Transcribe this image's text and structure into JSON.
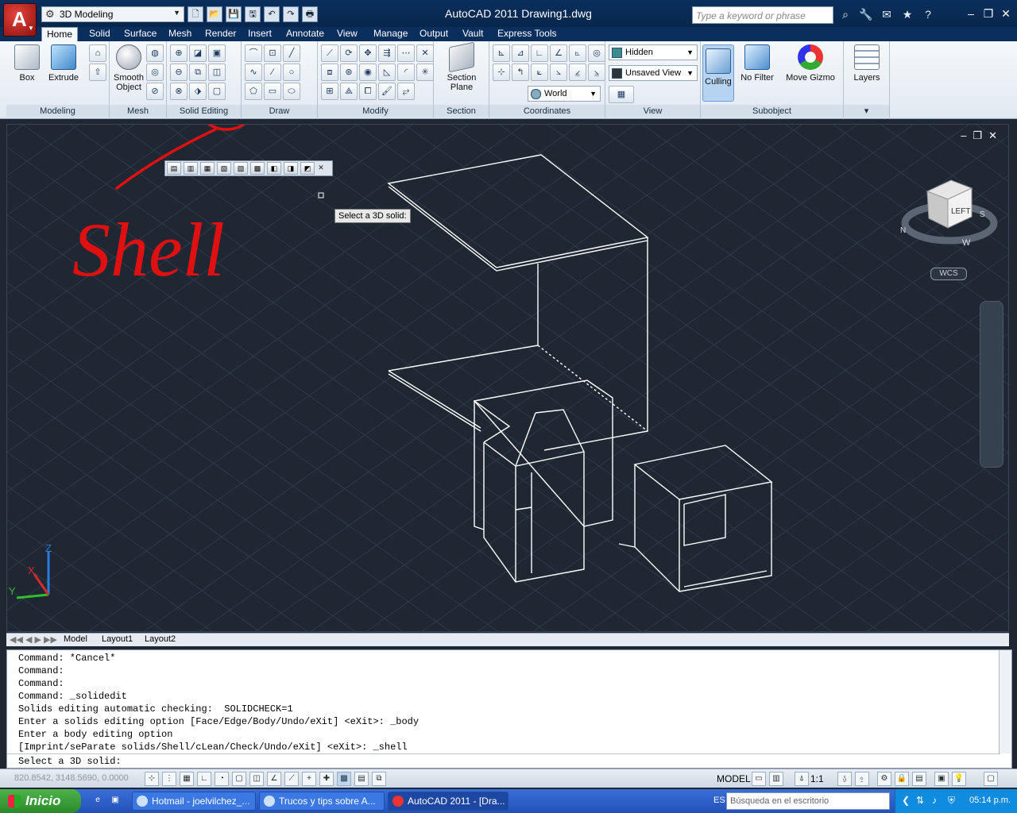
{
  "titlebar": {
    "workspace": "3D Modeling",
    "title": "AutoCAD 2011    Drawing1.dwg",
    "search_placeholder": "Type a keyword or phrase"
  },
  "tabs": [
    "Home",
    "Solid",
    "Surface",
    "Mesh",
    "Render",
    "Insert",
    "Annotate",
    "View",
    "Manage",
    "Output",
    "Vault",
    "Express Tools"
  ],
  "ribbon": {
    "modeling": {
      "title": "Modeling",
      "box": "Box",
      "extrude": "Extrude"
    },
    "mesh": {
      "title": "Mesh",
      "smooth": "Smooth Object"
    },
    "solid_editing": {
      "title": "Solid Editing"
    },
    "draw": {
      "title": "Draw"
    },
    "modify": {
      "title": "Modify"
    },
    "section": {
      "title": "Section",
      "plane": "Section Plane"
    },
    "coordinates": {
      "title": "Coordinates",
      "world": "World"
    },
    "view": {
      "title": "View",
      "visual_style": "Hidden",
      "saved_view": "Unsaved View"
    },
    "subobject": {
      "title": "Subobject",
      "culling": "Culling",
      "no_filter": "No Filter",
      "move_gizmo": "Move Gizmo"
    },
    "layers": {
      "label": "Layers"
    }
  },
  "viewport": {
    "tooltip": "Select a 3D solid:",
    "annotation": "Shell",
    "viewcube_face": "LEFT",
    "wcs": "WCS",
    "compass": {
      "n": "N",
      "s": "S",
      "w": "W"
    },
    "ucs": {
      "x": "X",
      "y": "Y",
      "z": "Z"
    }
  },
  "layout_tabs": [
    "Model",
    "Layout1",
    "Layout2"
  ],
  "command": {
    "history": [
      "Command: *Cancel*",
      "Command:",
      "Command:",
      "Command: _solidedit",
      "Solids editing automatic checking:  SOLIDCHECK=1",
      "Enter a solids editing option [Face/Edge/Body/Undo/eXit] <eXit>: _body",
      "Enter a body editing option",
      "[Imprint/seParate solids/Shell/cLean/Check/Undo/eXit] <eXit>: _shell"
    ],
    "prompt": "Select a 3D solid:"
  },
  "statusbar": {
    "coords": "820.8542, 3148.5690, 0.0000",
    "model": "MODEL",
    "scale": "1:1"
  },
  "taskbar": {
    "start": "Inicio",
    "tasks": [
      "Hotmail - joelvilchez_...",
      "Trucos y tips sobre A...",
      "AutoCAD 2011 - [Dra..."
    ],
    "lang": "ES",
    "search": "Búsqueda en el escritorio",
    "clock": "05:14 p.m."
  },
  "colors": {
    "annotation": "#e01010",
    "ribbon_bg": "#e8eef5",
    "viewport_bg": "#1f2733"
  }
}
